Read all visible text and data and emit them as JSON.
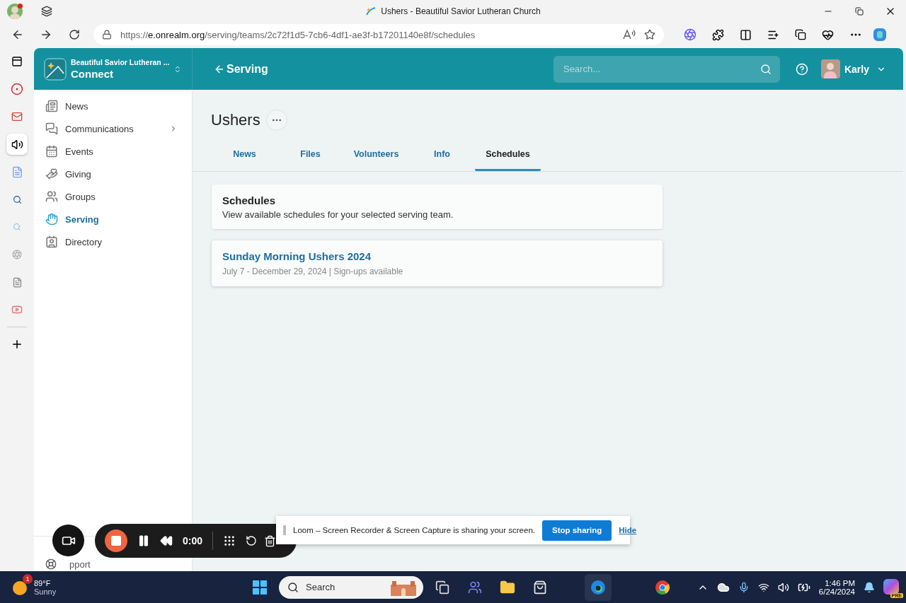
{
  "browser": {
    "title": "Ushers - Beautiful Savior Lutheran Church",
    "url_scheme": "https://",
    "url_host": "e.onrealm.org",
    "url_path": "/serving/teams/2c72f1d5-7cb6-4df1-ae3f-b17201140e8f/schedules"
  },
  "app": {
    "org_name": "Beautiful Savior Lutheran ...",
    "app_name": "Connect",
    "back_label": "Serving",
    "search": {
      "placeholder": "Search..."
    },
    "user_name": "Karly"
  },
  "sidebar": {
    "items": [
      {
        "label": "News",
        "kind": "news",
        "selected": false,
        "has_submenu": false
      },
      {
        "label": "Communications",
        "kind": "communications",
        "selected": false,
        "has_submenu": true
      },
      {
        "label": "Events",
        "kind": "events",
        "selected": false,
        "has_submenu": false
      },
      {
        "label": "Giving",
        "kind": "giving",
        "selected": false,
        "has_submenu": false
      },
      {
        "label": "Groups",
        "kind": "groups",
        "selected": false,
        "has_submenu": false
      },
      {
        "label": "Serving",
        "kind": "serving",
        "selected": true,
        "has_submenu": false
      },
      {
        "label": "Directory",
        "kind": "directory",
        "selected": false,
        "has_submenu": false
      }
    ],
    "support_label": "pport"
  },
  "page": {
    "title": "Ushers",
    "tabs": [
      {
        "label": "News",
        "selected": false
      },
      {
        "label": "Files",
        "selected": false
      },
      {
        "label": "Volunteers",
        "selected": false
      },
      {
        "label": "Info",
        "selected": false
      },
      {
        "label": "Schedules",
        "selected": true
      }
    ],
    "intro": {
      "title": "Schedules",
      "text": "View available schedules for your selected serving team."
    },
    "schedules": [
      {
        "title": "Sunday Morning Ushers 2024",
        "details": "July 7 - December 29, 2024 | Sign-ups available"
      }
    ]
  },
  "recorder": {
    "time": "0:00"
  },
  "share_notice": {
    "text": "Loom – Screen Recorder & Screen Capture is sharing your screen.",
    "stop_button": "Stop sharing",
    "hide_link": "Hide"
  },
  "taskbar": {
    "weather": {
      "temp": "89°F",
      "condition": "Sunny",
      "badge": "1"
    },
    "search": {
      "placeholder": "Search"
    },
    "time": "1:46 PM",
    "date": "6/24/2024",
    "copilot_badge": "PRE"
  }
}
